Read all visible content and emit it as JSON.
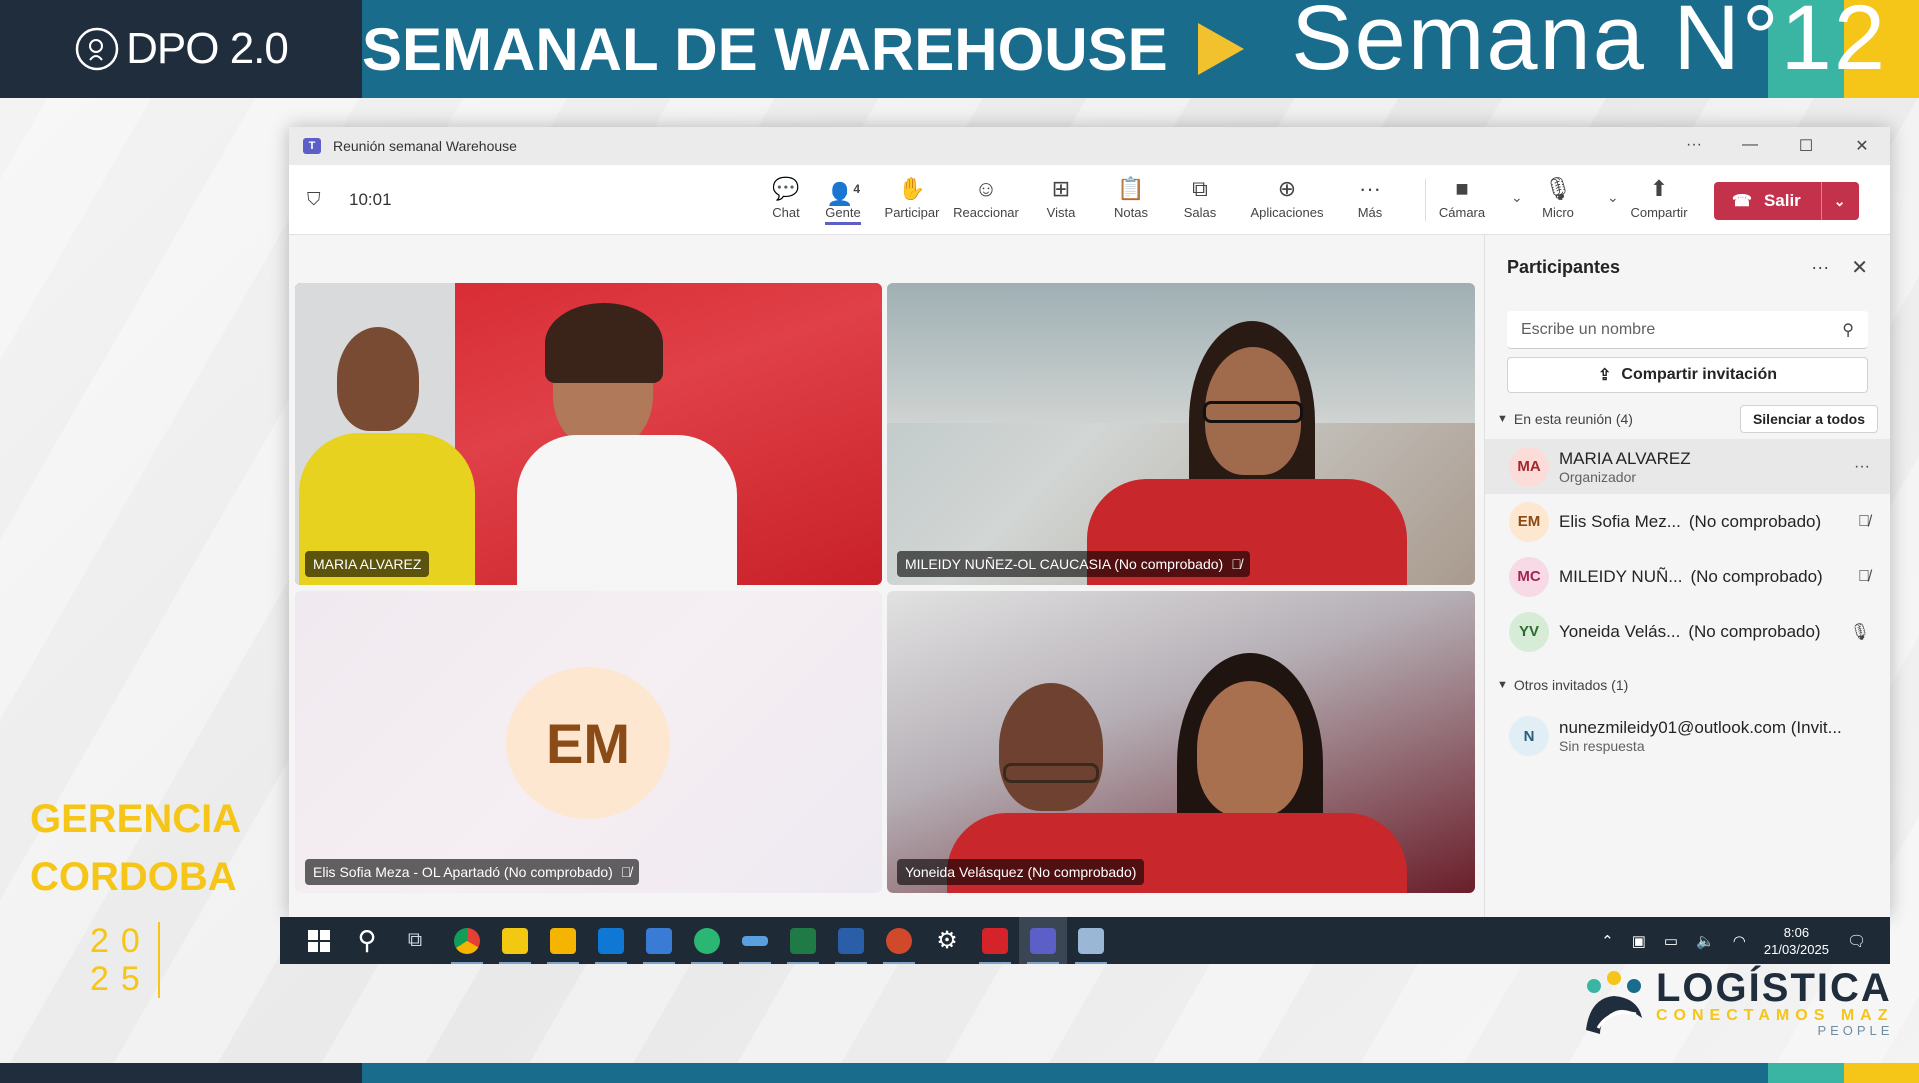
{
  "banner": {
    "brand": "DPO 2.0",
    "title": "SEMANAL DE WAREHOUSE",
    "week": "Semana N°12"
  },
  "side": {
    "gerencia_line1": "GERENCIA",
    "gerencia_line2": "CORDOBA",
    "year_top": "20",
    "year_bottom": "25"
  },
  "logo": {
    "main": "LOGÍSTICA",
    "sub": "CONECTAMOS MAZ",
    "sub2": "PEOPLE"
  },
  "window": {
    "title": "Reunión semanal Warehouse",
    "controls": [
      "···",
      "—",
      "☐",
      "✕"
    ]
  },
  "toolbar": {
    "time": "10:01",
    "buttons": [
      {
        "label": "Chat",
        "icon": "chat-icon",
        "glyph": "💬"
      },
      {
        "label": "Gente",
        "icon": "people-icon",
        "glyph": "👤",
        "badge": "4"
      },
      {
        "label": "Participar",
        "icon": "raise-hand-icon",
        "glyph": "✋"
      },
      {
        "label": "Reaccionar",
        "icon": "react-icon",
        "glyph": "☺"
      },
      {
        "label": "Vista",
        "icon": "view-icon",
        "glyph": "⊞"
      },
      {
        "label": "Notas",
        "icon": "notes-icon",
        "glyph": "📋"
      },
      {
        "label": "Salas",
        "icon": "rooms-icon",
        "glyph": "⧉"
      },
      {
        "label": "Aplicaciones",
        "icon": "apps-icon",
        "glyph": "⊕"
      },
      {
        "label": "Más",
        "icon": "more-icon",
        "glyph": "···"
      },
      {
        "label": "Cámara",
        "icon": "camera-icon",
        "glyph": "■"
      },
      {
        "label": "Micro",
        "icon": "mic-icon",
        "glyph": "🎙"
      },
      {
        "label": "Compartir",
        "icon": "share-screen-icon",
        "glyph": "⬆"
      }
    ],
    "leave": "Salir"
  },
  "tiles": [
    {
      "name": "MARIA ALVAREZ",
      "muted": false
    },
    {
      "name": "MILEIDY NUÑEZ-OL CAUCASIA (No comprobado)",
      "muted": true
    },
    {
      "name": "Elis Sofia Meza - OL Apartadó (No comprobado)",
      "muted": true,
      "initials": "EM"
    },
    {
      "name": "Yoneida Velásquez (No comprobado)",
      "muted": false
    }
  ],
  "panel": {
    "title": "Participantes",
    "search_placeholder": "Escribe un nombre",
    "share_invite": "Compartir invitación",
    "in_meeting": "En esta reunión (4)",
    "mute_all": "Silenciar a todos",
    "others": "Otros invitados (1)",
    "participants": [
      {
        "initials": "MA",
        "name": "MARIA ALVAREZ",
        "role": "Organizador",
        "status": "",
        "bg": "#fcdcd8",
        "fg": "#a4262c",
        "icon": "···"
      },
      {
        "initials": "EM",
        "name": "Elis Sofia Mez...",
        "role": "",
        "status": "(No comprobado)",
        "bg": "#fde7d0",
        "fg": "#8a4b16",
        "icon": "🎙̸"
      },
      {
        "initials": "MC",
        "name": "MILEIDY NUÑ...",
        "role": "",
        "status": "(No comprobado)",
        "bg": "#f8d9e6",
        "fg": "#a4264f",
        "icon": "🎙̸"
      },
      {
        "initials": "YV",
        "name": "Yoneida Velás...",
        "role": "",
        "status": "(No comprobado)",
        "bg": "#d6ecd6",
        "fg": "#2c6b2c",
        "icon": "🎙"
      }
    ],
    "invited": {
      "initials": "N",
      "name": "nunezmileidy01@outlook.com (Invit...",
      "role": "Sin respuesta"
    }
  },
  "taskbar": {
    "clock_time": "8:06",
    "clock_date": "21/03/2025",
    "apps": [
      {
        "name": "start-icon",
        "color": "#ffffff"
      },
      {
        "name": "search-icon",
        "color": "#ffffff"
      },
      {
        "name": "task-view-icon",
        "color": "#cfd8e3"
      },
      {
        "name": "chrome-icon",
        "color": "#e34133"
      },
      {
        "name": "powerbi-icon",
        "color": "#f2c811"
      },
      {
        "name": "file-explorer-icon",
        "color": "#f4b400"
      },
      {
        "name": "outlook-icon",
        "color": "#0f78d4"
      },
      {
        "name": "app-grid-icon",
        "color": "#3a7bd5"
      },
      {
        "name": "edge-icon",
        "color": "#2ab673"
      },
      {
        "name": "app-stripe-icon",
        "color": "#5a9fe0"
      },
      {
        "name": "excel-icon",
        "color": "#1f7a45"
      },
      {
        "name": "word-icon",
        "color": "#2b5ea8"
      },
      {
        "name": "powerpoint-icon",
        "color": "#d0492b"
      },
      {
        "name": "settings-icon",
        "color": "#ffffff"
      },
      {
        "name": "acrobat-icon",
        "color": "#d5232a"
      },
      {
        "name": "teams-icon",
        "color": "#5b5fc7"
      },
      {
        "name": "remote-app-icon",
        "color": "#9ab7d6"
      }
    ]
  }
}
